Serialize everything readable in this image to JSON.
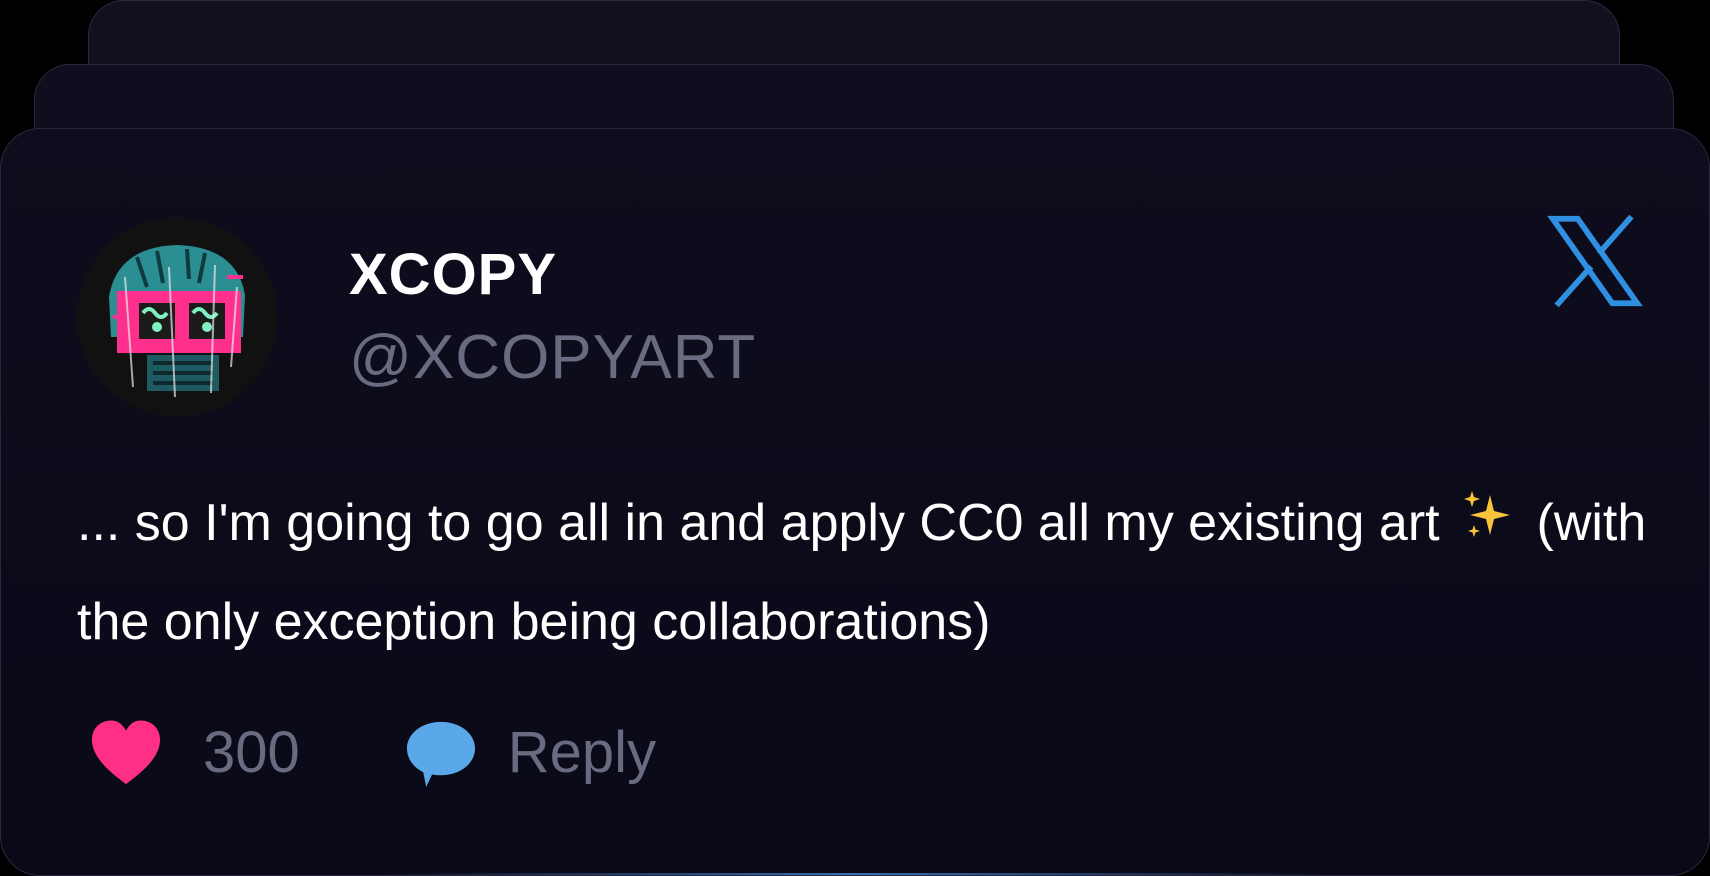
{
  "tweet": {
    "author": {
      "display_name": "XCOPY",
      "handle": "@XCOPYART"
    },
    "text_before_emoji": "... so I'm going to go all in and apply CC0 all my existing art",
    "emoji": "sparkles",
    "text_after_emoji": "(with the only exception being collaborations)",
    "likes": "300",
    "reply_label": "Reply"
  },
  "icons": {
    "platform": "x-logo-icon",
    "like": "heart-icon",
    "reply": "speech-bubble-icon"
  },
  "colors": {
    "background": "#000000",
    "card": "#0d0c1c",
    "text_primary": "#ffffff",
    "text_muted": "#6a6a80",
    "x_logo": "#2f8fe0",
    "heart": "#ff2f86",
    "reply_bubble": "#5aa7ea",
    "sparkle": "#f6c33a"
  }
}
